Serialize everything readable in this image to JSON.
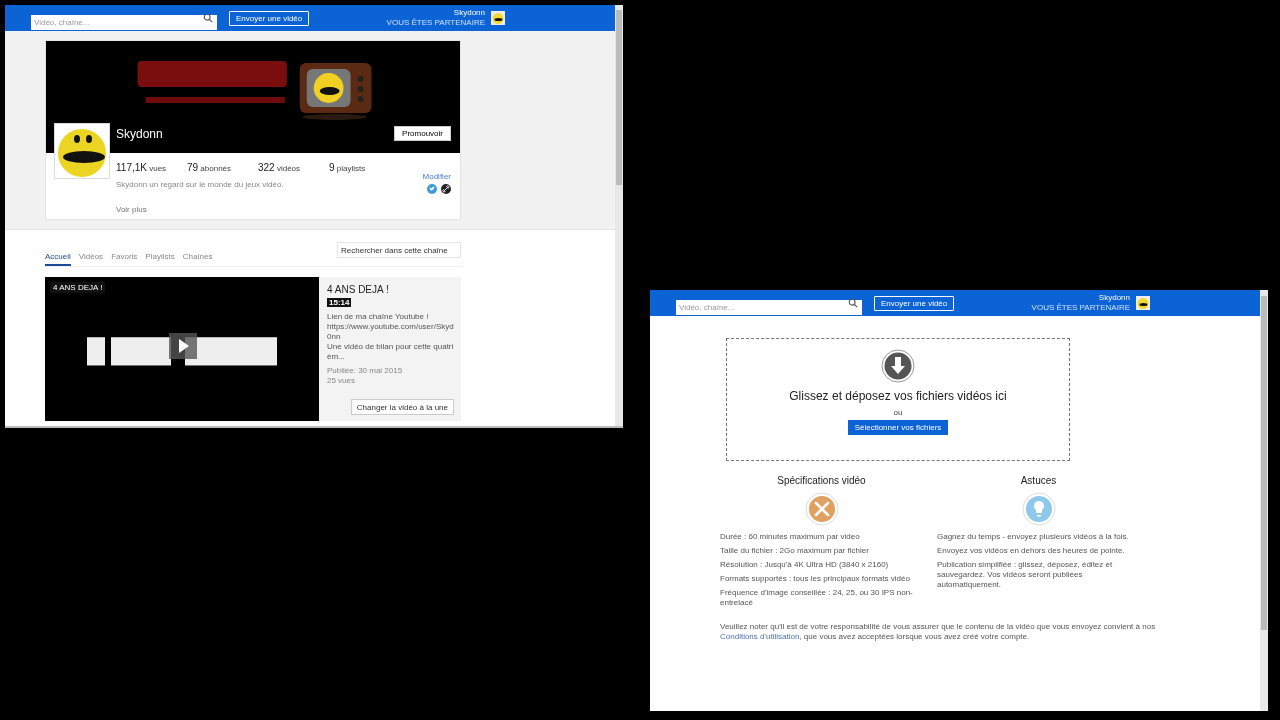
{
  "channel_window": {
    "header": {
      "search_placeholder": "Vidéo, chaîne...",
      "upload_button": "Envoyer une vidéo",
      "user_name": "Skydonn",
      "partner_label": "VOUS ÊTES PARTENAIRE"
    },
    "channel": {
      "name": "Skydonn",
      "promote_button": "Promouvoir",
      "stats": [
        {
          "value": "117,1K",
          "unit": "vues"
        },
        {
          "value": "79",
          "unit": "abonnés"
        },
        {
          "value": "322",
          "unit": "vidéos"
        },
        {
          "value": "9",
          "unit": "playlists"
        }
      ],
      "description": "Skydonn un regard sur le monde du jeux vidéo.",
      "see_more": "Voir plus",
      "edit_link": "Modifier"
    },
    "tabs": [
      {
        "label": "Accueil",
        "selected": true
      },
      {
        "label": "Vidéos",
        "selected": false
      },
      {
        "label": "Favoris",
        "selected": false
      },
      {
        "label": "Playlists",
        "selected": false
      },
      {
        "label": "Chaînes",
        "selected": false
      }
    ],
    "channel_search_placeholder": "Rechercher dans cette chaîne",
    "featured_video": {
      "overlay_title": "4 ANS DEJA !",
      "title": "4 ANS DEJA !",
      "duration": "15:14",
      "description": [
        "Lien de ma chaîne Youtube !",
        "https://www.youtube.com/user/Skyd0nn",
        "Une vidéo de bilan pour cette quatrièm..."
      ],
      "published": "Publiée: 30 mai 2015",
      "views": "25 vues",
      "change_button": "Changer la vidéo à la une"
    }
  },
  "upload_window": {
    "header": {
      "search_placeholder": "Vidéo, chaîne...",
      "upload_button": "Envoyer une vidéo",
      "user_name": "Skydonn",
      "partner_label": "VOUS ÊTES PARTENAIRE"
    },
    "dropzone": {
      "title": "Glissez et déposez vos fichiers vidéos ici",
      "or": "ou",
      "select_button": "Sélectionner vos fichiers"
    },
    "columns": [
      {
        "kind": "specs",
        "title": "Spécifications vidéo",
        "items": [
          "Durée : 60 minutes maximum par video",
          "Taille du fichier : 2Go maximum par fichier",
          "Résolution : Jusqu'à 4K Ultra HD (3840 x 2160)",
          "Formats supportés : tous les principaux formats vidéo",
          "Fréquence d'image conseillée : 24, 25, ou 30 IPS non-entrelacé"
        ]
      },
      {
        "kind": "tips",
        "title": "Astuces",
        "items": [
          "Gagnez du temps - envoyez plusieurs vidéos à la fois.",
          "Envoyez vos vidéos en dehors des heures de pointe.",
          "Publication simplifiée : glissez, déposez, éditez et sauvegardez. Vos vidéos seront publiées automatiquement."
        ]
      }
    ],
    "note": {
      "before": "Veuillez noter qu'il est de votre responsabilité de vous assurer que le contenu de la vidéo que vous envoyez convient à nos ",
      "link": "Conditions d'utilisation",
      "after": ", que vous avez acceptées lorsque vous avez créé votre compte."
    }
  }
}
